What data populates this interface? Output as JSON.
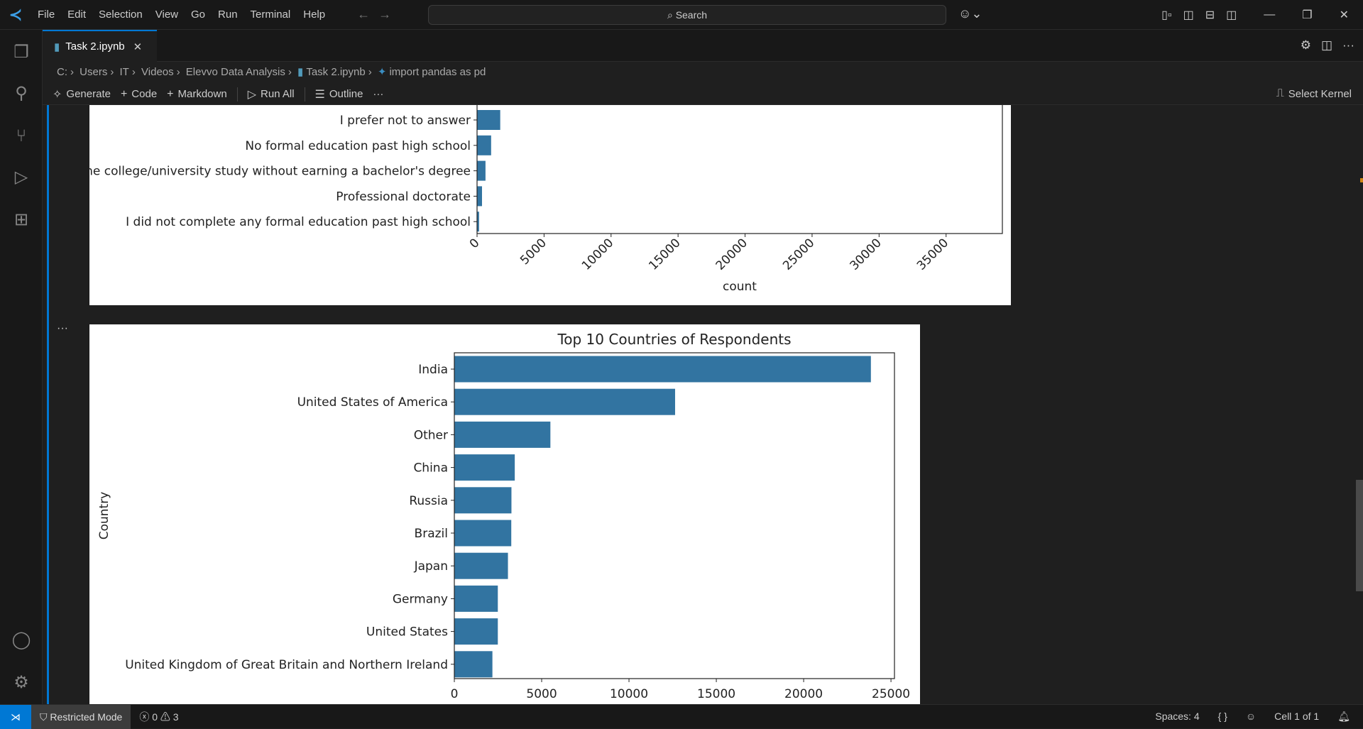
{
  "menu": [
    "File",
    "Edit",
    "Selection",
    "View",
    "Go",
    "Run",
    "Terminal",
    "Help"
  ],
  "search": {
    "placeholder": "Search"
  },
  "tab": {
    "label": "Task 2.ipynb"
  },
  "breadcrumb": [
    "C:",
    "Users",
    "IT",
    "Videos",
    "Elevvo Data Analysis",
    "Task 2.ipynb",
    "import pandas as pd"
  ],
  "toolbar": {
    "generate": "Generate",
    "code": "Code",
    "markdown": "Markdown",
    "run_all": "Run All",
    "outline": "Outline",
    "more": "···",
    "select_kernel": "Select Kernel"
  },
  "cell": {
    "more": "···"
  },
  "status": {
    "restricted": "Restricted Mode",
    "errors": "0",
    "warnings": "3",
    "spaces": "Spaces: 4",
    "braces": "{ }",
    "cell": "Cell 1 of 1"
  },
  "chart_data": [
    {
      "type": "bar",
      "orientation": "horizontal",
      "title": "",
      "xlabel": "count",
      "ylabel": "",
      "categories": [
        "I prefer not to answer",
        "No formal education past high school",
        "Some college/university study without earning a bachelor's degree",
        "Professional doctorate",
        "I did not complete any formal education past high school"
      ],
      "values": [
        1730,
        1050,
        630,
        370,
        150
      ],
      "xlim": [
        0,
        39200
      ],
      "xticks": [
        0,
        5000,
        10000,
        15000,
        20000,
        25000,
        30000,
        35000
      ],
      "xtick_rotation": 45,
      "color": "#3274a1",
      "partially_visible": true
    },
    {
      "type": "bar",
      "orientation": "horizontal",
      "title": "Top 10 Countries of Respondents",
      "xlabel": "",
      "ylabel": "Country",
      "categories": [
        "India",
        "United States of America",
        "Other",
        "China",
        "Russia",
        "Brazil",
        "Japan",
        "Germany",
        "United States",
        "United Kingdom of Great Britain and Northern Ireland"
      ],
      "values": [
        23850,
        12640,
        5500,
        3460,
        3270,
        3260,
        3070,
        2490,
        2490,
        2180
      ],
      "xlim": [
        0,
        25200
      ],
      "xticks": [
        0,
        5000,
        10000,
        15000,
        20000,
        25000
      ],
      "color": "#3274a1"
    }
  ]
}
